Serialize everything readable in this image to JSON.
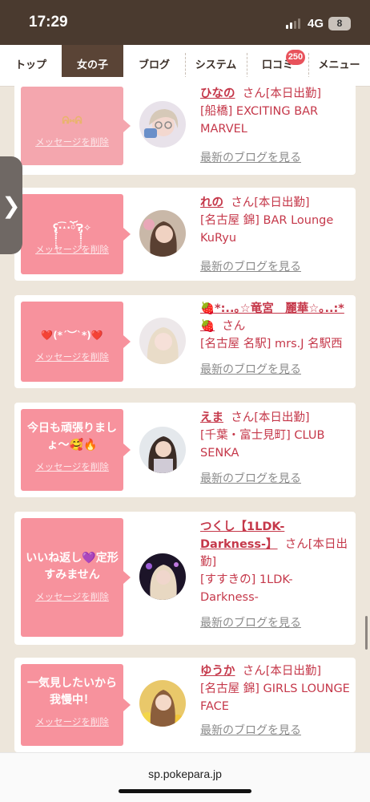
{
  "status": {
    "time": "17:29",
    "network": "4G",
    "battery": "8"
  },
  "tabs": [
    {
      "label": "トップ"
    },
    {
      "label": "女の子"
    },
    {
      "label": "ブログ"
    },
    {
      "label": "システム"
    },
    {
      "label": "口コミ"
    },
    {
      "label": "メニュー"
    }
  ],
  "reviews_badge": "250",
  "delete_label": "メッセージを削除",
  "blog_label": "最新のブログを見る",
  "cards": [
    {
      "message": "ᕱ⑅ᕱ",
      "name": "ひなの",
      "honorific": "さん[本日出勤]",
      "shop": "[船橋] EXCITING BAR MARVEL"
    },
    {
      "message": "ʕ̢̣̣̣̣̩̩̩̩·͡˔·ོɁ̡̣̣̣̣̩̩̩̩✧",
      "name": "れの",
      "honorific": "さん[本日出勤]",
      "shop": "[名古屋 錦] BAR Lounge KuRyu"
    },
    {
      "message": "❤️(*´︶`*)❤️",
      "name": "🍓*:..｡☆竜宮　麗華☆｡..:*🍓",
      "honorific": "さん",
      "shop": "[名古屋 名駅] mrs.J 名駅西"
    },
    {
      "message": "今日も頑張りましょ〜🥰🔥",
      "name": "えま",
      "honorific": "さん[本日出勤]",
      "shop": "[千葉・富士見町] CLUB SENKA"
    },
    {
      "message": "いいね返し💜定形すみません",
      "name": "つくし【1LDK-Darkness-】",
      "honorific": "さん[本日出勤]",
      "shop": "[すすきの] 1LDK-Darkness-"
    },
    {
      "message": "一気見したいから我慢中！",
      "name": "ゆうか",
      "honorific": "さん[本日出勤]",
      "shop": "[名古屋 錦] GIRLS LOUNGE FACE"
    }
  ],
  "url": "sp.pokepara.jp",
  "colors": {
    "header_bg": "#4a3a2f",
    "active_tab": "#5a4436",
    "bubble": "#f7929d",
    "accent_text": "#c5384a",
    "badge": "#e8525b",
    "page_bg": "#ede6db"
  }
}
